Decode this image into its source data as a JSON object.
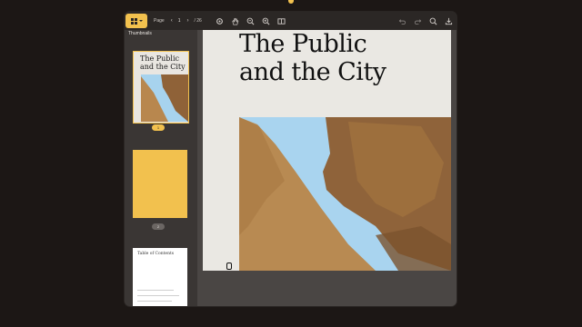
{
  "toolbar": {
    "page_label": "Page",
    "prev_label": "‹",
    "next_label": "›",
    "current_page": "1",
    "total_pages": "/ 26",
    "accent": "#f2c14e"
  },
  "icons": [
    "grid-icon",
    "gear-icon",
    "hand-icon",
    "zoom-out-icon",
    "zoom-in-icon",
    "two-page-icon",
    "undo-icon",
    "redo-icon",
    "search-icon",
    "download-icon"
  ],
  "sidebar": {
    "title": "Thumbnails",
    "thumbnails": [
      {
        "label": "1",
        "title": "The Public and the City",
        "selected": true
      },
      {
        "label": "2"
      },
      {
        "label": "",
        "title": "Table of Contents"
      }
    ]
  },
  "document": {
    "title": "The Public and the City"
  }
}
